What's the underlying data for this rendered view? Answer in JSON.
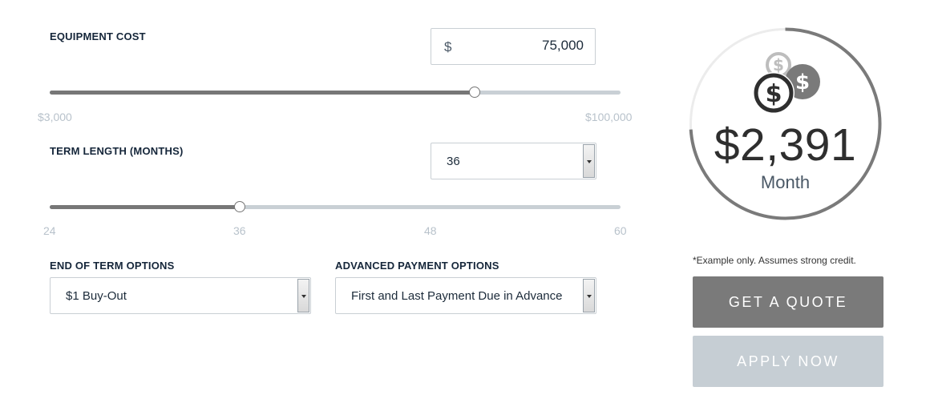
{
  "equipment_cost": {
    "label": "EQUIPMENT COST",
    "currency_symbol": "$",
    "value": "75,000",
    "min_label": "$3,000",
    "max_label": "$100,000",
    "slider_fraction": 0.7448
  },
  "term_length": {
    "label": "TERM LENGTH (MONTHS)",
    "selected": "36",
    "ticks": [
      "24",
      "36",
      "48",
      "60"
    ],
    "slider_fraction": 0.3333
  },
  "end_of_term": {
    "label": "END OF TERM OPTIONS",
    "selected": "$1 Buy-Out"
  },
  "advanced_payment": {
    "label": "ADVANCED PAYMENT OPTIONS",
    "selected": "First and Last Payment Due in Advance"
  },
  "summary": {
    "payment": "$2,391",
    "period": "Month",
    "icon": "coins-dollar-icon",
    "ring_fraction": 0.74,
    "disclaimer": "*Example only. Assumes strong credit."
  },
  "actions": {
    "quote_label": "GET A QUOTE",
    "apply_label": "APPLY NOW"
  },
  "colors": {
    "dark_fill": "#777777",
    "track": "#c9d0d5",
    "quote_bg": "#7a7a7a",
    "apply_bg": "#c6ced4",
    "label_text": "#15263a"
  }
}
